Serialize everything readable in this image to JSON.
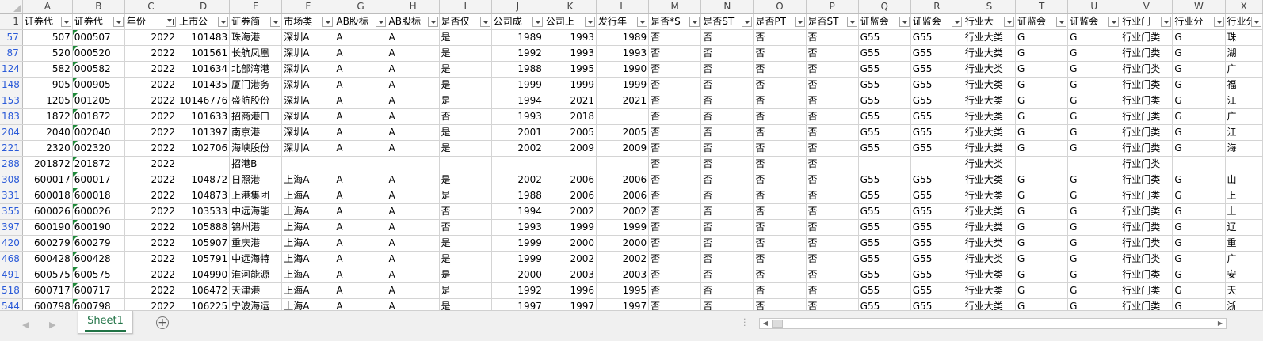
{
  "columns": [
    "A",
    "B",
    "C",
    "D",
    "E",
    "F",
    "G",
    "H",
    "I",
    "J",
    "K",
    "L",
    "M",
    "N",
    "O",
    "P",
    "Q",
    "R",
    "S",
    "T",
    "U",
    "V",
    "W",
    "X"
  ],
  "header_row": {
    "num": "1",
    "cells": [
      "证券代",
      "证券代",
      "年份",
      "上市公",
      "证券简",
      "市场类",
      "AB股标",
      "AB股标",
      "是否仅",
      "公司成",
      "公司上",
      "发行年",
      "是否*S",
      "是否ST",
      "是否PT",
      "是否ST",
      "证监会",
      "证监会",
      "行业大",
      "证监会",
      "证监会",
      "行业门",
      "行业分",
      "行业分"
    ],
    "filter_active_column": "C"
  },
  "rows": [
    {
      "num": "57",
      "cells": [
        "507",
        "000507",
        "2022",
        "101483",
        "珠海港",
        "深圳A",
        "A",
        "A",
        "是",
        "1989",
        "1993",
        "1989",
        "否",
        "否",
        "否",
        "否",
        "G55",
        "G55",
        "行业大类",
        "G",
        "G",
        "行业门类",
        "G",
        "珠"
      ]
    },
    {
      "num": "87",
      "cells": [
        "520",
        "000520",
        "2022",
        "101561",
        "长航凤凰",
        "深圳A",
        "A",
        "A",
        "是",
        "1992",
        "1993",
        "1993",
        "否",
        "否",
        "否",
        "否",
        "G55",
        "G55",
        "行业大类",
        "G",
        "G",
        "行业门类",
        "G",
        "湖"
      ]
    },
    {
      "num": "124",
      "cells": [
        "582",
        "000582",
        "2022",
        "101634",
        "北部湾港",
        "深圳A",
        "A",
        "A",
        "是",
        "1988",
        "1995",
        "1990",
        "否",
        "否",
        "否",
        "否",
        "G55",
        "G55",
        "行业大类",
        "G",
        "G",
        "行业门类",
        "G",
        "广"
      ]
    },
    {
      "num": "148",
      "cells": [
        "905",
        "000905",
        "2022",
        "101435",
        "厦门港务",
        "深圳A",
        "A",
        "A",
        "是",
        "1999",
        "1999",
        "1999",
        "否",
        "否",
        "否",
        "否",
        "G55",
        "G55",
        "行业大类",
        "G",
        "G",
        "行业门类",
        "G",
        "福"
      ]
    },
    {
      "num": "153",
      "cells": [
        "1205",
        "001205",
        "2022",
        "10146776",
        "盛航股份",
        "深圳A",
        "A",
        "A",
        "是",
        "1994",
        "2021",
        "2021",
        "否",
        "否",
        "否",
        "否",
        "G55",
        "G55",
        "行业大类",
        "G",
        "G",
        "行业门类",
        "G",
        "江"
      ]
    },
    {
      "num": "183",
      "cells": [
        "1872",
        "001872",
        "2022",
        "101633",
        "招商港口",
        "深圳A",
        "A",
        "A",
        "否",
        "1993",
        "2018",
        "",
        "否",
        "否",
        "否",
        "否",
        "G55",
        "G55",
        "行业大类",
        "G",
        "G",
        "行业门类",
        "G",
        "广"
      ]
    },
    {
      "num": "204",
      "cells": [
        "2040",
        "002040",
        "2022",
        "101397",
        "南京港",
        "深圳A",
        "A",
        "A",
        "是",
        "2001",
        "2005",
        "2005",
        "否",
        "否",
        "否",
        "否",
        "G55",
        "G55",
        "行业大类",
        "G",
        "G",
        "行业门类",
        "G",
        "江"
      ]
    },
    {
      "num": "221",
      "cells": [
        "2320",
        "002320",
        "2022",
        "102706",
        "海峡股份",
        "深圳A",
        "A",
        "A",
        "是",
        "2002",
        "2009",
        "2009",
        "否",
        "否",
        "否",
        "否",
        "G55",
        "G55",
        "行业大类",
        "G",
        "G",
        "行业门类",
        "G",
        "海"
      ]
    },
    {
      "num": "288",
      "cells": [
        "201872",
        "201872",
        "2022",
        "",
        "招港B",
        "",
        "",
        "",
        "",
        "",
        "",
        "",
        "否",
        "否",
        "否",
        "否",
        "",
        "",
        "行业大类",
        "",
        "",
        "行业门类",
        "",
        ""
      ]
    },
    {
      "num": "308",
      "cells": [
        "600017",
        "600017",
        "2022",
        "104872",
        "日照港",
        "上海A",
        "A",
        "A",
        "是",
        "2002",
        "2006",
        "2006",
        "否",
        "否",
        "否",
        "否",
        "G55",
        "G55",
        "行业大类",
        "G",
        "G",
        "行业门类",
        "G",
        "山"
      ]
    },
    {
      "num": "331",
      "cells": [
        "600018",
        "600018",
        "2022",
        "104873",
        "上港集团",
        "上海A",
        "A",
        "A",
        "是",
        "1988",
        "2006",
        "2006",
        "否",
        "否",
        "否",
        "否",
        "G55",
        "G55",
        "行业大类",
        "G",
        "G",
        "行业门类",
        "G",
        "上"
      ]
    },
    {
      "num": "355",
      "cells": [
        "600026",
        "600026",
        "2022",
        "103533",
        "中远海能",
        "上海A",
        "A",
        "A",
        "否",
        "1994",
        "2002",
        "2002",
        "否",
        "否",
        "否",
        "否",
        "G55",
        "G55",
        "行业大类",
        "G",
        "G",
        "行业门类",
        "G",
        "上"
      ]
    },
    {
      "num": "397",
      "cells": [
        "600190",
        "600190",
        "2022",
        "105888",
        "锦州港",
        "上海A",
        "A",
        "A",
        "否",
        "1993",
        "1999",
        "1999",
        "否",
        "否",
        "否",
        "否",
        "G55",
        "G55",
        "行业大类",
        "G",
        "G",
        "行业门类",
        "G",
        "辽"
      ]
    },
    {
      "num": "420",
      "cells": [
        "600279",
        "600279",
        "2022",
        "105907",
        "重庆港",
        "上海A",
        "A",
        "A",
        "是",
        "1999",
        "2000",
        "2000",
        "否",
        "否",
        "否",
        "否",
        "G55",
        "G55",
        "行业大类",
        "G",
        "G",
        "行业门类",
        "G",
        "重"
      ]
    },
    {
      "num": "468",
      "cells": [
        "600428",
        "600428",
        "2022",
        "105791",
        "中远海特",
        "上海A",
        "A",
        "A",
        "是",
        "1999",
        "2002",
        "2002",
        "否",
        "否",
        "否",
        "否",
        "G55",
        "G55",
        "行业大类",
        "G",
        "G",
        "行业门类",
        "G",
        "广"
      ]
    },
    {
      "num": "491",
      "cells": [
        "600575",
        "600575",
        "2022",
        "104990",
        "淮河能源",
        "上海A",
        "A",
        "A",
        "是",
        "2000",
        "2003",
        "2003",
        "否",
        "否",
        "否",
        "否",
        "G55",
        "G55",
        "行业大类",
        "G",
        "G",
        "行业门类",
        "G",
        "安"
      ]
    },
    {
      "num": "518",
      "cells": [
        "600717",
        "600717",
        "2022",
        "106472",
        "天津港",
        "上海A",
        "A",
        "A",
        "是",
        "1992",
        "1996",
        "1995",
        "否",
        "否",
        "否",
        "否",
        "G55",
        "G55",
        "行业大类",
        "G",
        "G",
        "行业门类",
        "G",
        "天"
      ]
    },
    {
      "num": "544",
      "cells": [
        "600798",
        "600798",
        "2022",
        "106225",
        "宁波海运",
        "上海A",
        "A",
        "A",
        "是",
        "1997",
        "1997",
        "1997",
        "否",
        "否",
        "否",
        "否",
        "G55",
        "G55",
        "行业大类",
        "G",
        "G",
        "行业门类",
        "G",
        "浙"
      ]
    }
  ],
  "sheet_tabs": [
    {
      "label": "Sheet1",
      "active": true
    }
  ],
  "icons": {
    "add_sheet": "plus-circle-icon",
    "nav_prev": "triangle-left-icon",
    "nav_next": "triangle-right-icon",
    "filter": "dropdown-filter-icon",
    "scroll_left": "scroll-left-icon",
    "scroll_right": "scroll-right-icon",
    "options": "vertical-dots-icon"
  },
  "colors": {
    "accent": "#217346",
    "row_number": "#2a5ad8",
    "number_marker": "#1f8a3a"
  }
}
